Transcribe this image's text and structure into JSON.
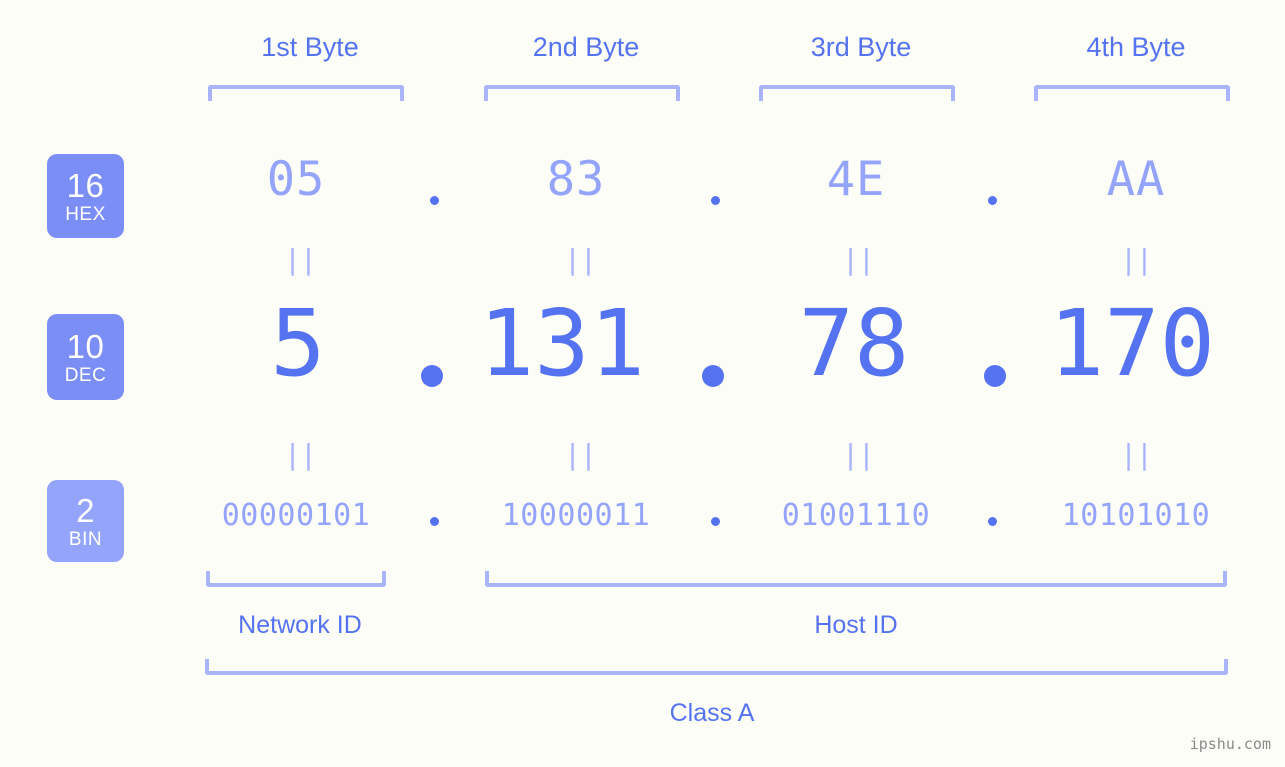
{
  "background_color": "#fdfdf8",
  "colors": {
    "accent_strong": "#5573f0",
    "accent_light": "#93a4fa",
    "bracket": "#aab4fc",
    "badge_dark": "#7b8ef5",
    "badge_light": "#93a4fa",
    "watermark": "#8a8a8a"
  },
  "byte_headers": [
    {
      "label": "1st Byte"
    },
    {
      "label": "2nd Byte"
    },
    {
      "label": "3rd Byte"
    },
    {
      "label": "4th Byte"
    }
  ],
  "rows": {
    "hex": {
      "badge_number": "16",
      "badge_unit": "HEX",
      "values": [
        "05",
        "83",
        "4E",
        "AA"
      ],
      "separator": "."
    },
    "dec": {
      "badge_number": "10",
      "badge_unit": "DEC",
      "values": [
        "5",
        "131",
        "78",
        "170"
      ],
      "separator": "."
    },
    "bin": {
      "badge_number": "2",
      "badge_unit": "BIN",
      "values": [
        "00000101",
        "10000011",
        "01001110",
        "10101010"
      ],
      "separator": "."
    }
  },
  "equality_mark": "||",
  "sections": {
    "network_id": "Network ID",
    "host_id": "Host ID",
    "class": "Class A"
  },
  "watermark": "ipshu.com",
  "ip_address": "5.131.78.170"
}
